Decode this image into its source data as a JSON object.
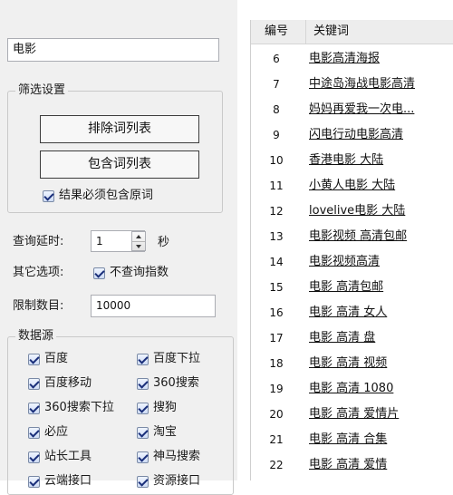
{
  "query": {
    "value": "电影"
  },
  "filter": {
    "title": "筛选设置",
    "exclude_button": "排除词列表",
    "include_button": "包含词列表",
    "must_contain_label": "结果必须包含原词"
  },
  "delay": {
    "label": "查询延时:",
    "value": "1",
    "unit": "秒"
  },
  "other": {
    "label": "其它选项:",
    "no_index_label": "不查询指数"
  },
  "limit": {
    "label": "限制数目:",
    "value": "10000"
  },
  "sources": {
    "title": "数据源",
    "items": [
      {
        "label": "百度"
      },
      {
        "label": "百度下拉"
      },
      {
        "label": "百度移动"
      },
      {
        "label": "360搜索"
      },
      {
        "label": "360搜索下拉"
      },
      {
        "label": "搜狗"
      },
      {
        "label": "必应"
      },
      {
        "label": "淘宝"
      },
      {
        "label": "站长工具"
      },
      {
        "label": "神马搜索"
      },
      {
        "label": "云端接口"
      },
      {
        "label": "资源接口"
      }
    ]
  },
  "table": {
    "headers": {
      "id": "编号",
      "keyword": "关键词"
    },
    "rows": [
      {
        "id": "6",
        "keyword": "电影高清海报"
      },
      {
        "id": "7",
        "keyword": "中途岛海战电影高清"
      },
      {
        "id": "8",
        "keyword": "妈妈再爱我一次电..."
      },
      {
        "id": "9",
        "keyword": "闪电行动电影高清"
      },
      {
        "id": "10",
        "keyword": "香港电影 大陆"
      },
      {
        "id": "11",
        "keyword": "小黄人电影 大陆"
      },
      {
        "id": "12",
        "keyword": "lovelive电影 大陆"
      },
      {
        "id": "13",
        "keyword": "电影视频 高清包邮"
      },
      {
        "id": "14",
        "keyword": "电影视频高清"
      },
      {
        "id": "15",
        "keyword": "电影 高清包邮"
      },
      {
        "id": "16",
        "keyword": "电影 高清 女人"
      },
      {
        "id": "17",
        "keyword": "电影 高清 盘"
      },
      {
        "id": "18",
        "keyword": "电影 高清 视频"
      },
      {
        "id": "19",
        "keyword": "电影 高清 1080"
      },
      {
        "id": "20",
        "keyword": "电影 高清 爱情片"
      },
      {
        "id": "21",
        "keyword": "电影 高清 合集"
      },
      {
        "id": "22",
        "keyword": "电影 高清 爱情"
      }
    ]
  }
}
